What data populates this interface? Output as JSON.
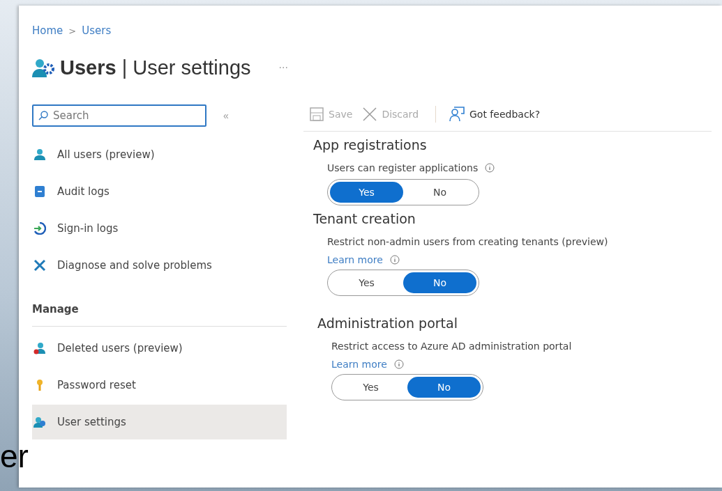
{
  "backdrop_text": "er",
  "breadcrumb": [
    {
      "label": "Home"
    },
    {
      "label": "Users"
    }
  ],
  "breadcrumb_separator": ">",
  "title": {
    "main": "Users",
    "separator": "|",
    "sub": "User settings",
    "more": "···"
  },
  "sidebar": {
    "search": {
      "placeholder": "Search"
    },
    "collapse": "«",
    "items": [
      {
        "label": "All users (preview)",
        "kind": "user",
        "selected": false
      },
      {
        "label": "Audit logs",
        "kind": "log",
        "selected": false
      },
      {
        "label": "Sign-in logs",
        "kind": "signin",
        "selected": false
      },
      {
        "label": "Diagnose and solve problems",
        "kind": "tools",
        "selected": false
      }
    ],
    "sections": [
      {
        "heading": "Manage",
        "items": [
          {
            "label": "Deleted users (preview)",
            "kind": "deleted",
            "selected": false
          },
          {
            "label": "Password reset",
            "kind": "key",
            "selected": false
          },
          {
            "label": "User settings",
            "kind": "settings",
            "selected": true
          }
        ]
      }
    ]
  },
  "toolbar": [
    {
      "label": "Save",
      "kind": "save",
      "disabled": true
    },
    {
      "label": "Discard",
      "kind": "close",
      "disabled": true
    },
    {
      "label": "Got feedback?",
      "kind": "feedback",
      "disabled": false
    }
  ],
  "settings": [
    {
      "heading": "App registrations",
      "description": "Users can register applications",
      "options": [
        {
          "label": "Yes",
          "selected": true
        },
        {
          "label": "No",
          "selected": false
        }
      ]
    },
    {
      "heading": "Tenant creation",
      "description": "Restrict non-admin users from creating tenants (preview)",
      "link": "Learn more",
      "options": [
        {
          "label": "Yes",
          "selected": false
        },
        {
          "label": "No",
          "selected": true
        }
      ]
    },
    {
      "heading": "Administration portal",
      "description": "Restrict access to Azure AD administration portal",
      "link": "Learn more",
      "options": [
        {
          "label": "Yes",
          "selected": false
        },
        {
          "label": "No",
          "selected": true
        }
      ]
    }
  ]
}
